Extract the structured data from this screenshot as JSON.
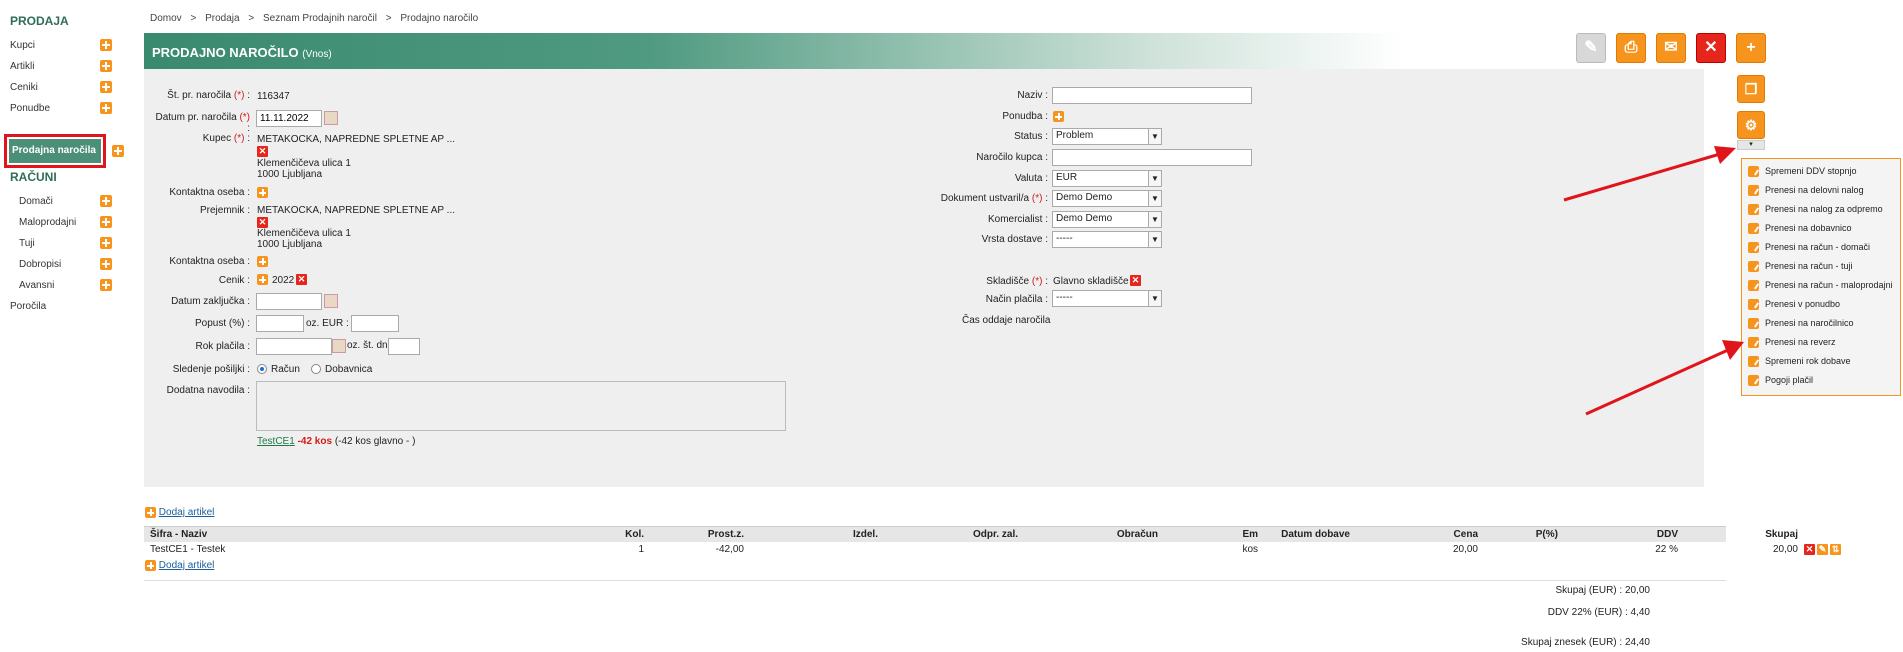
{
  "sidebar": {
    "section1": "PRODAJA",
    "items1": [
      {
        "label": "Kupci"
      },
      {
        "label": "Artikli"
      },
      {
        "label": "Ceniki"
      },
      {
        "label": "Ponudbe"
      },
      {
        "label": "Prodajna naročila"
      }
    ],
    "section2": "RAČUNI",
    "items2": [
      {
        "label": "Domači"
      },
      {
        "label": "Maloprodajni"
      },
      {
        "label": "Tuji"
      },
      {
        "label": "Dobropisi"
      },
      {
        "label": "Avansni"
      }
    ],
    "reports": "Poročila"
  },
  "breadcrumb": [
    "Domov",
    ">",
    "Prodaja",
    ">",
    "Seznam Prodajnih naročil",
    ">",
    "Prodajno naročilo"
  ],
  "header": {
    "title": "PRODAJNO NAROČILO",
    "mode": "(Vnos)"
  },
  "form_left": {
    "order_no_label": "Št. pr. naročila",
    "order_no": "116347",
    "order_date_label": "Datum pr. naročila",
    "order_date": "11.11.2022",
    "buyer_label": "Kupec",
    "buyer_name": "METAKOCKA, NAPREDNE SPLETNE AP ...",
    "buyer_street": "Klemenčičeva ulica 1",
    "buyer_city": "1000 Ljubljana",
    "contact_label": "Kontaktna oseba",
    "recipient_label": "Prejemnik",
    "recipient_name": "METAKOCKA, NAPREDNE SPLETNE AP ...",
    "recipient_street": "Klemenčičeva ulica 1",
    "recipient_city": "1000 Ljubljana",
    "contact2_label": "Kontaktna oseba",
    "pricelist_label": "Cenik",
    "pricelist": "2022",
    "close_date_label": "Datum zaključka",
    "discount_label": "Popust (%)",
    "discount_eur_label": "oz. EUR",
    "due_label": "Rok plačila",
    "days_label": "oz. št. dni",
    "tracking_label": "Sledenje pošiljki",
    "tracking_opt1": "Račun",
    "tracking_opt2": "Dobavnica",
    "instructions_label": "Dodatna navodila",
    "stock_link": "TestCE1",
    "stock_qty": "-42 kos",
    "stock_detail": "(-42 kos glavno - )"
  },
  "form_right": {
    "name_label": "Naziv",
    "offer_label": "Ponudba",
    "status_label": "Status",
    "status_value": "Problem",
    "buyer_order_label": "Naročilo kupca",
    "currency_label": "Valuta",
    "currency_value": "EUR",
    "doc_created_label": "Dokument ustvaril/a",
    "doc_created_value": "Demo Demo",
    "commercialist_label": "Komercialist",
    "commercialist_value": "Demo Demo",
    "delivery_label": "Vrsta dostave",
    "delivery_value": "-----",
    "warehouse_label": "Skladišče",
    "warehouse_value": "Glavno skladišče",
    "payment_label": "Način plačila",
    "payment_value": "-----",
    "order_time_label": "Čas oddaje naročila"
  },
  "menu": [
    "Spremeni DDV stopnjo",
    "Prenesi na delovni nalog",
    "Prenesi na nalog za odpremo",
    "Prenesi na dobavnico",
    "Prenesi na račun - domači",
    "Prenesi na račun - tuji",
    "Prenesi na račun - maloprodajni",
    "Prenesi v ponudbo",
    "Prenesi na naročilnico",
    "Prenesi na reverz",
    "Spremeni rok dobave",
    "Pogoji plačil"
  ],
  "table": {
    "add_label": "Dodaj artikel",
    "headers": [
      "Šifra - Naziv",
      "Kol.",
      "Prost.z.",
      "Izdel.",
      "Odpr. zal.",
      "Obračun",
      "Em",
      "Datum dobave",
      "Cena",
      "P(%)",
      "DDV",
      "Skupaj"
    ],
    "row": {
      "code": "TestCE1 - Testek",
      "qty": "1",
      "stock": "-42,00",
      "unit": "kos",
      "price": "20,00",
      "vat": "22 %",
      "total": "20,00"
    }
  },
  "totals": {
    "sum_label": "Skupaj (EUR) :",
    "sum": "20,00",
    "vat_label": "DDV 22% (EUR) :",
    "vat": "4,40",
    "grand_label": "Skupaj znesek (EUR) :",
    "grand": "24,40"
  }
}
